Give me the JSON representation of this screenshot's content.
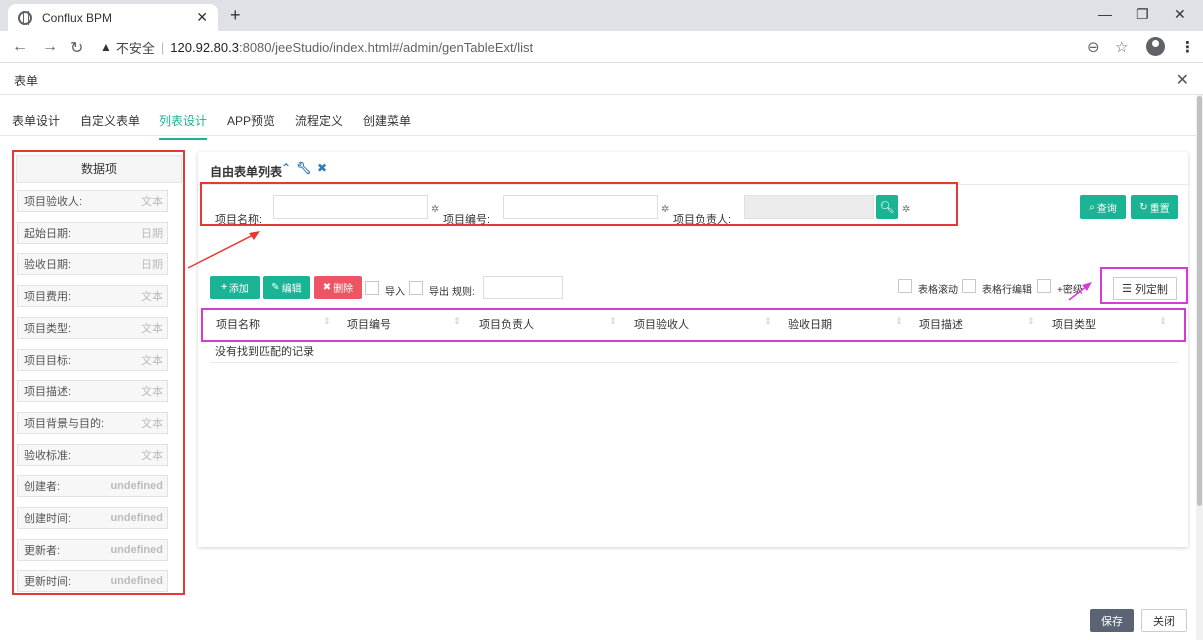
{
  "browser": {
    "tab_title": "Conflux BPM",
    "insecure_label": "不安全",
    "separator": "|",
    "url_host": "120.92.80.3",
    "url_path": ":8080/jeeStudio/index.html#/admin/genTableExt/list"
  },
  "modal": {
    "title": "表单"
  },
  "tabs": [
    {
      "label": "表单设计"
    },
    {
      "label": "自定义表单"
    },
    {
      "label": "列表设计"
    },
    {
      "label": "APP预览"
    },
    {
      "label": "流程定义"
    },
    {
      "label": "创建菜单"
    }
  ],
  "data_panel": {
    "title": "数据项",
    "fields": [
      {
        "name": "项目验收人:",
        "type": "文本"
      },
      {
        "name": "起始日期:",
        "type": "日期"
      },
      {
        "name": "验收日期:",
        "type": "日期"
      },
      {
        "name": "项目费用:",
        "type": "文本"
      },
      {
        "name": "项目类型:",
        "type": "文本"
      },
      {
        "name": "项目目标:",
        "type": "文本"
      },
      {
        "name": "项目描述:",
        "type": "文本"
      },
      {
        "name": "项目背景与目的:",
        "type": "文本"
      },
      {
        "name": "验收标准:",
        "type": "文本"
      },
      {
        "name": "创建者:",
        "type": "undefined"
      },
      {
        "name": "创建时间:",
        "type": "undefined"
      },
      {
        "name": "更新者:",
        "type": "undefined"
      },
      {
        "name": "更新时间:",
        "type": "undefined"
      }
    ]
  },
  "list_panel": {
    "title": "自由表单列表",
    "search": {
      "name_label": "项目名称:",
      "code_label": "项目编号:",
      "owner_label": "项目负责人:"
    },
    "query_button": "查询",
    "reset_button": "重置",
    "toolbar": {
      "add": "添加",
      "edit": "编辑",
      "delete": "删除",
      "import": "导入",
      "export": "导出",
      "rule": "规则:",
      "table_scroll": "表格滚动",
      "row_edit": "表格行编辑",
      "security": "+密级",
      "column_custom": "列定制"
    },
    "columns": [
      "项目名称",
      "项目编号",
      "项目负责人",
      "项目验收人",
      "验收日期",
      "项目描述",
      "项目类型"
    ],
    "empty_text": "没有找到匹配的记录"
  },
  "footer": {
    "save": "保存",
    "close": "关闭"
  },
  "colors": {
    "accent": "#1ab394",
    "danger": "#ed5565",
    "highlight_red": "#e53935",
    "highlight_magenta": "#d63bd6"
  }
}
